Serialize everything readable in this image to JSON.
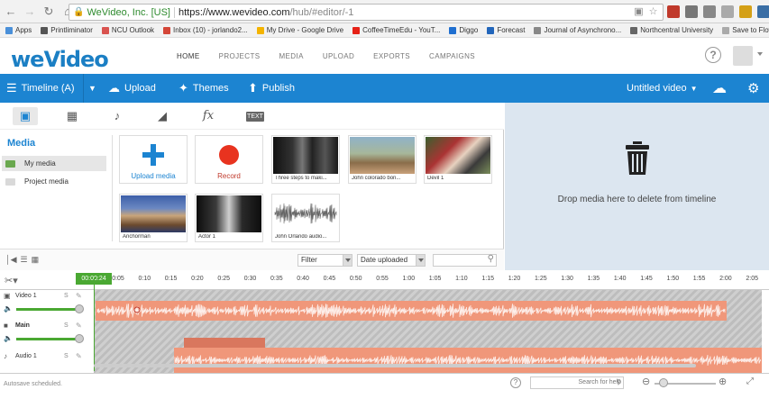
{
  "browser": {
    "ev_label": "WeVideo, Inc. [US]",
    "url": "https://www.wevideo.com",
    "url_path": "/hub/#editor/-1",
    "bookmarks": [
      {
        "label": "Apps",
        "color": "#4a90d9"
      },
      {
        "label": "Printliminator",
        "color": "#555555"
      },
      {
        "label": "NCU Outlook",
        "color": "#d9534f"
      },
      {
        "label": "Inbox (10) - jorlando2...",
        "color": "#d44638"
      },
      {
        "label": "My Drive - Google Drive",
        "color": "#f4b400"
      },
      {
        "label": "CoffeeTimeEdu - YouT...",
        "color": "#e62117"
      },
      {
        "label": "Diggo",
        "color": "#1f6fd0"
      },
      {
        "label": "Forecast",
        "color": "#2266bb"
      },
      {
        "label": "Journal of Asynchrono...",
        "color": "#888888"
      },
      {
        "label": "Northcentral University",
        "color": "#666666"
      },
      {
        "label": "Save to Flow",
        "color": "#aaaaaa"
      }
    ]
  },
  "header": {
    "logo": "weVideo",
    "nav": [
      "HOME",
      "PROJECTS",
      "MEDIA",
      "UPLOAD",
      "EXPORTS",
      "CAMPAIGNS"
    ]
  },
  "toolbar": {
    "timeline_label": "Timeline (A)",
    "upload_label": "Upload",
    "themes_label": "Themes",
    "publish_label": "Publish",
    "project_title": "Untitled video"
  },
  "media": {
    "title": "Media",
    "folders": [
      "My media",
      "Project media"
    ],
    "actions": {
      "upload": "Upload media",
      "record": "Record"
    },
    "items": [
      {
        "caption": "Three steps to maki..."
      },
      {
        "caption": "John colorado bon..."
      },
      {
        "caption": "Devil 1"
      },
      {
        "caption": "Anchorman"
      },
      {
        "caption": "Actor 1"
      },
      {
        "caption": "John Orlando audio..."
      }
    ],
    "filter_label": "Filter",
    "sort_label": "Date uploaded",
    "trash_text": "Drop media here to delete from timeline"
  },
  "timeline": {
    "playhead_time": "00:00:24",
    "ticks": [
      "0:05",
      "0:10",
      "0:15",
      "0:20",
      "0:25",
      "0:30",
      "0:35",
      "0:40",
      "0:45",
      "0:50",
      "0:55",
      "1:00",
      "1:05",
      "1:10",
      "1:15",
      "1:20",
      "1:25",
      "1:30",
      "1:35",
      "1:40",
      "1:45",
      "1:50",
      "1:55",
      "2:00",
      "2:05"
    ],
    "tracks": [
      {
        "name": "Video 1",
        "s": "S"
      },
      {
        "name": "Main",
        "s": "S"
      },
      {
        "name": "Audio 1",
        "s": "S"
      }
    ],
    "autosave": "Autosave scheduled.",
    "search_placeholder": "Search for help"
  },
  "colors": {
    "brand_blue": "#1c84d1",
    "trash_bg": "#dce6f0",
    "audio_clip": "#f0977a",
    "playhead": "#4aa832"
  }
}
